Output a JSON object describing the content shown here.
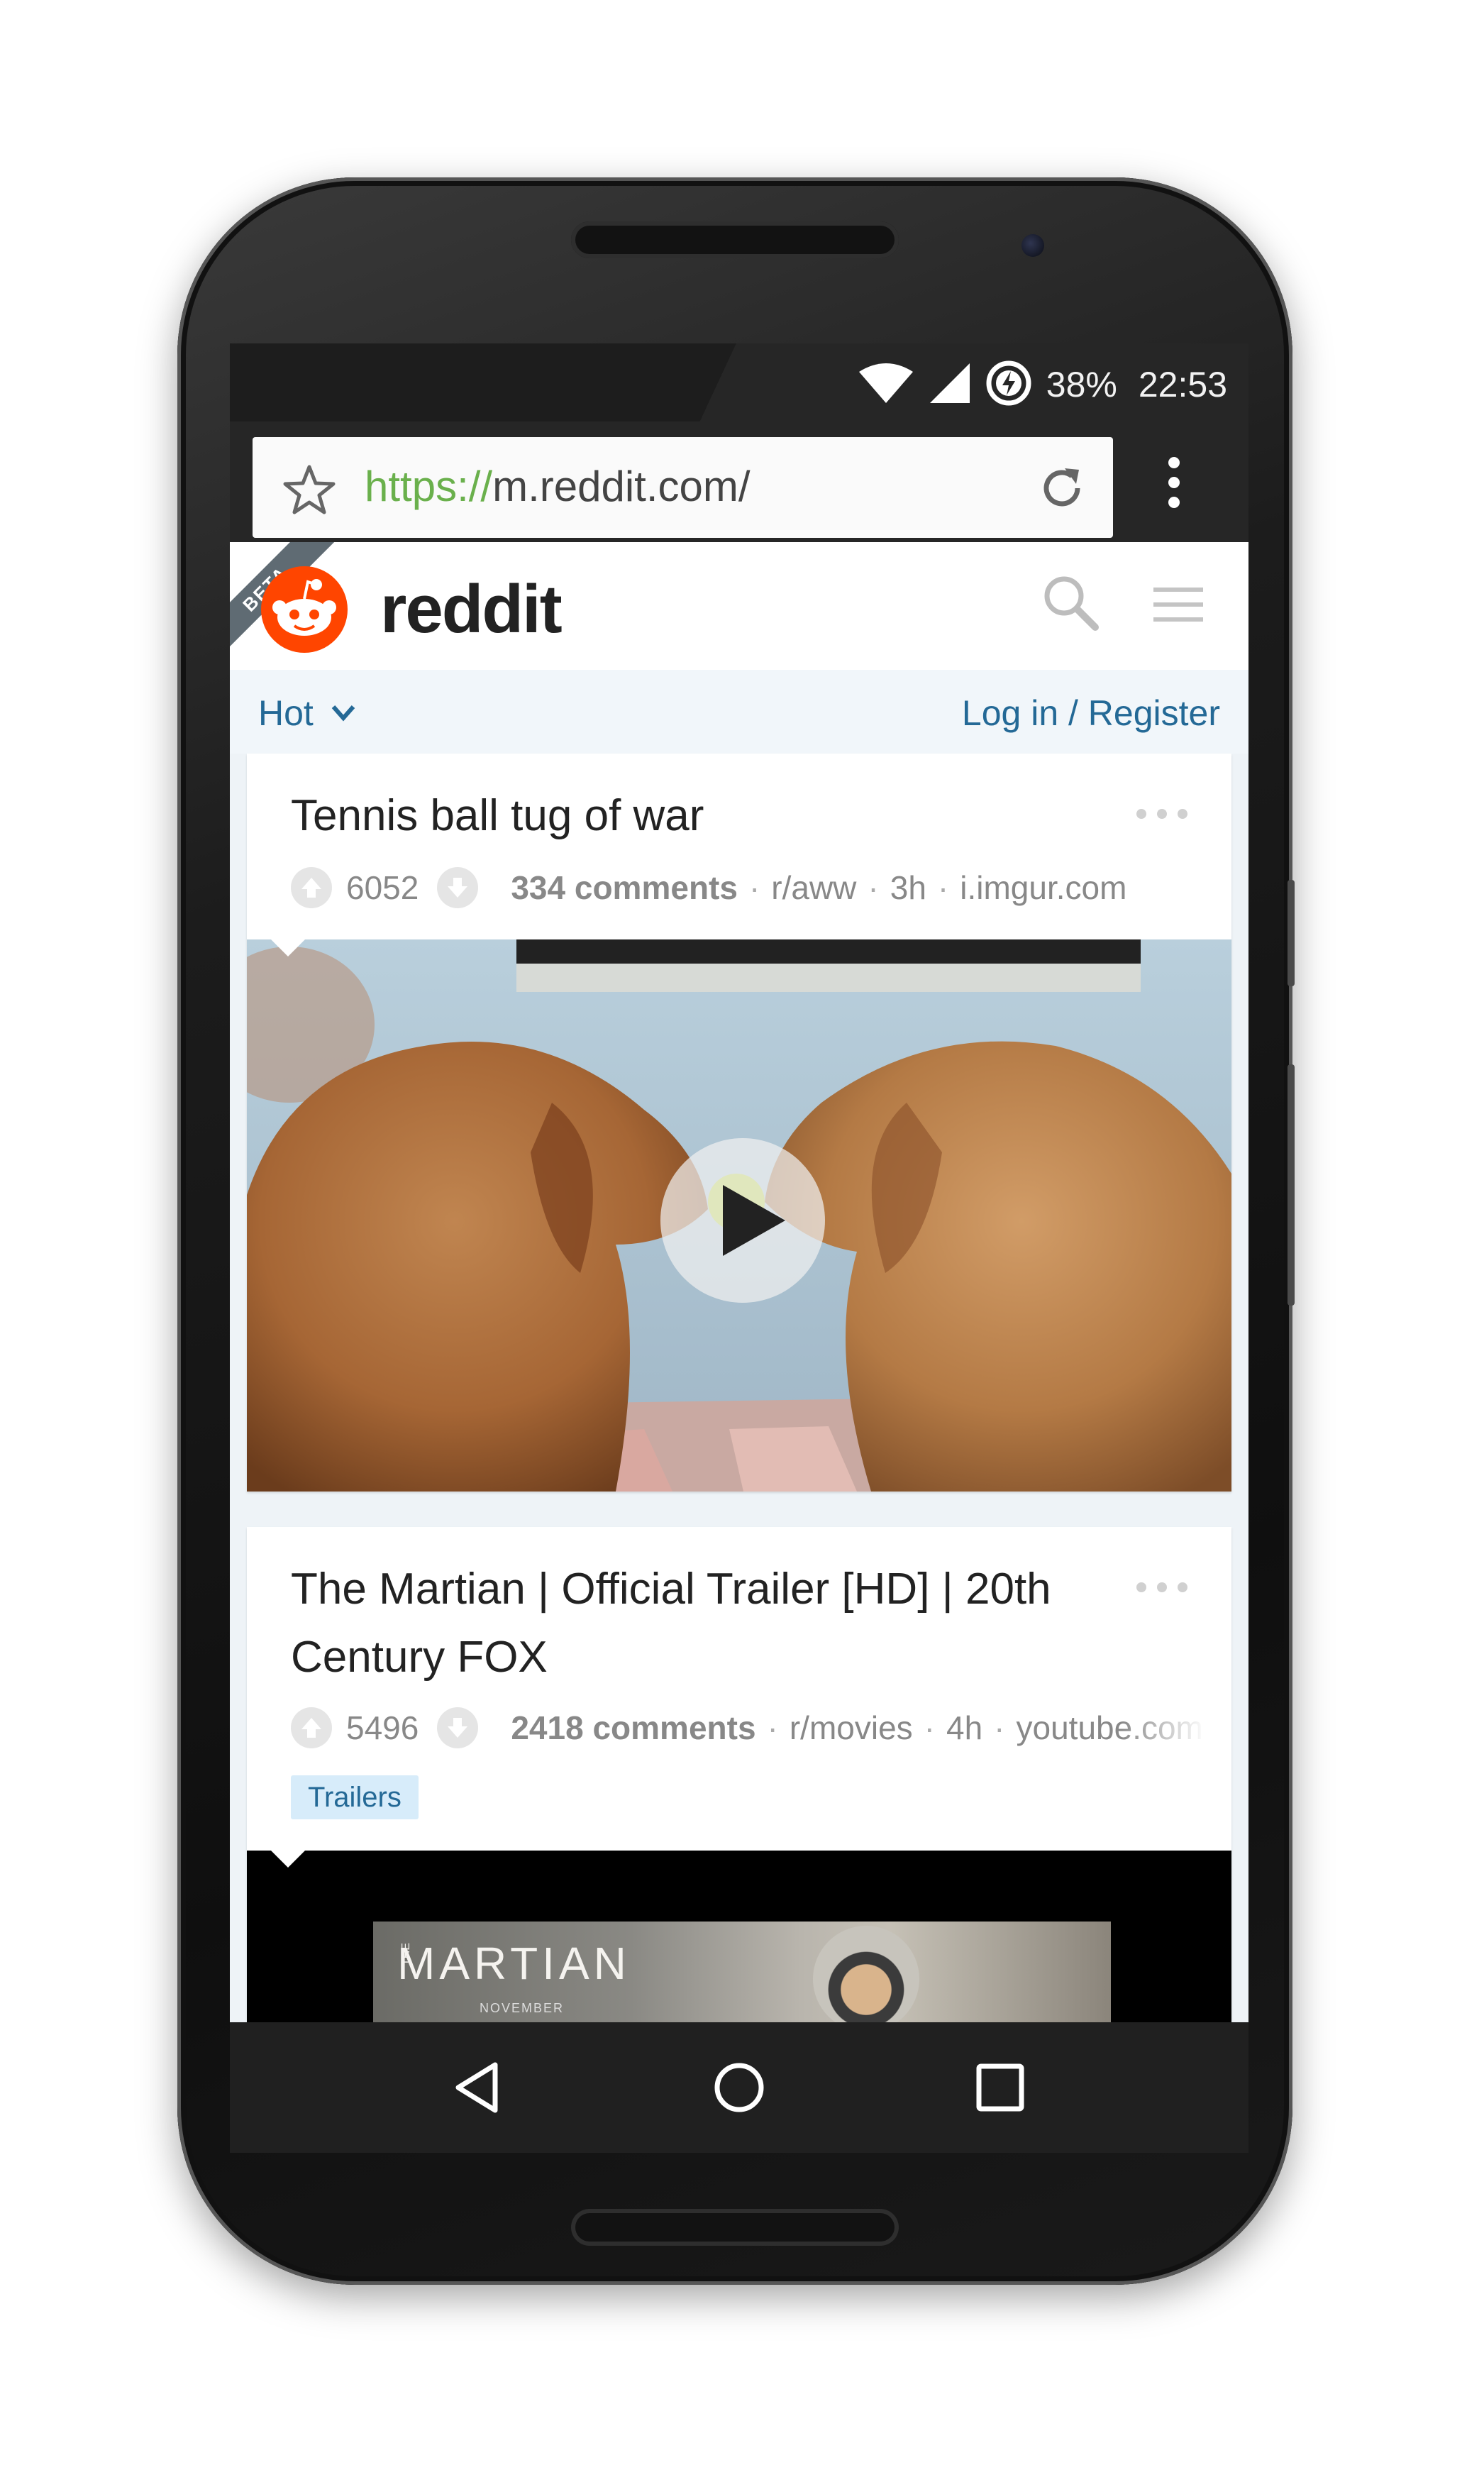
{
  "status_bar": {
    "battery": "38%",
    "time": "22:53",
    "icons": [
      "wifi-icon",
      "cell-signal-icon",
      "battery-charging-icon"
    ]
  },
  "browser": {
    "url_scheme": "https://",
    "url_host": "m.reddit.com/",
    "icons": [
      "star-icon",
      "refresh-icon",
      "menu-dots-icon"
    ]
  },
  "site_header": {
    "beta_label": "BETA",
    "wordmark": "reddit",
    "icons": [
      "reddit-logo-icon",
      "search-icon",
      "hamburger-menu-icon"
    ]
  },
  "sort_bar": {
    "sort": "Hot",
    "login": "Log in / Register"
  },
  "posts": [
    {
      "title": "Tennis ball tug of war",
      "score": "6052",
      "comments": "334 comments",
      "subreddit": "r/aww",
      "age": "3h",
      "domain": "i.imgur.com"
    },
    {
      "title": "The Martian | Official Trailer [HD] | 20th Century FOX",
      "score": "5496",
      "comments": "2418 comments",
      "subreddit": "r/movies",
      "age": "4h",
      "domain": "youtube.com",
      "flair": "Trailers",
      "thumb_title": "MARTIAN",
      "thumb_the": "THE",
      "thumb_sub": "NOVEMBER"
    }
  ],
  "colors": {
    "accent_link": "#246996",
    "reddit_orange": "#ff4500",
    "url_green": "#6ab04c"
  }
}
